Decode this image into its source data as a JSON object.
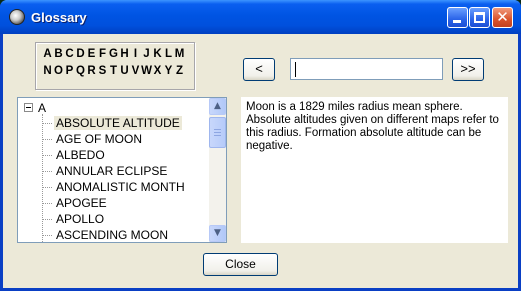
{
  "window": {
    "title": "Glossary",
    "accent": "#0054e3"
  },
  "alphabet": {
    "row1": [
      "A",
      "B",
      "C",
      "D",
      "E",
      "F",
      "G",
      "H",
      "I",
      "J",
      "K",
      "L",
      "M"
    ],
    "row2": [
      "N",
      "O",
      "P",
      "Q",
      "R",
      "S",
      "T",
      "U",
      "V",
      "W",
      "X",
      "Y",
      "Z"
    ]
  },
  "nav": {
    "prev_label": "<",
    "next_label": ">>",
    "search_value": ""
  },
  "tree": {
    "root_label": "A",
    "items": [
      "ABSOLUTE ALTITUDE",
      "AGE OF MOON",
      "ALBEDO",
      "ANNULAR ECLIPSE",
      "ANOMALISTIC MONTH",
      "APOGEE",
      "APOLLO",
      "ASCENDING MOON"
    ],
    "selected_index": 0
  },
  "description": "Moon is a 1829 miles radius mean sphere. Absolute altitudes given on different maps refer to this radius. Formation absolute altitude can be negative.",
  "footer": {
    "close_label": "Close"
  }
}
